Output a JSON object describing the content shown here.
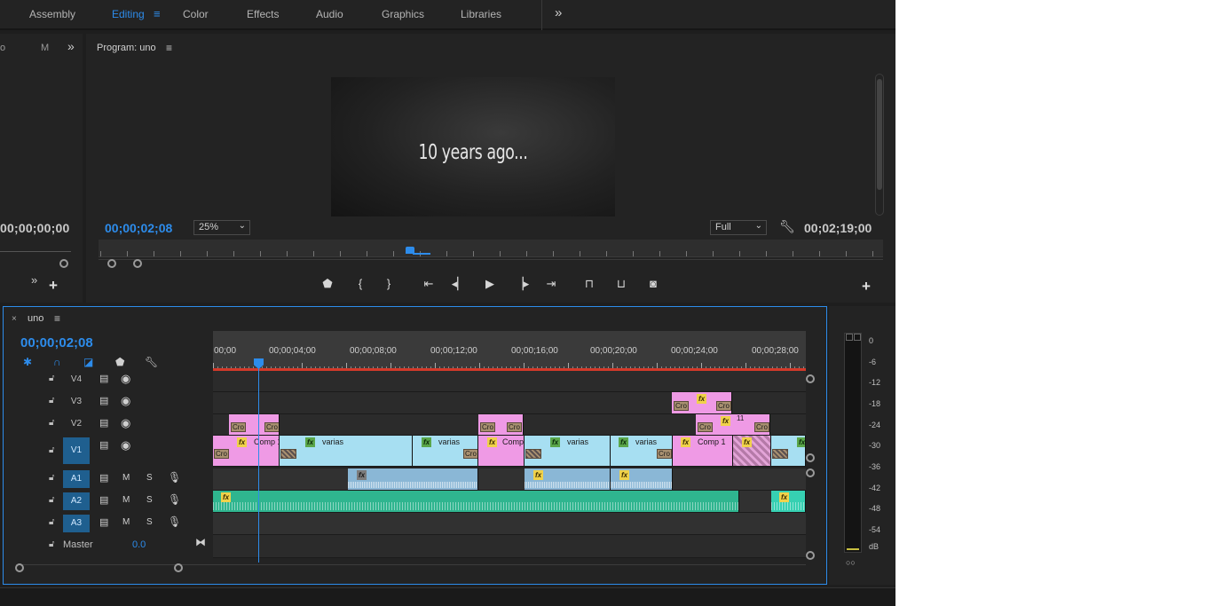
{
  "workspace": {
    "tabs": [
      "Assembly",
      "Editing",
      "Color",
      "Effects",
      "Audio",
      "Graphics",
      "Libraries"
    ],
    "active": "Editing",
    "more_label": "»"
  },
  "source": {
    "tab_partial_1": "o",
    "tab_partial_2": "M",
    "more_label": "»",
    "timecode": "00;00;00;00",
    "add_label": "+"
  },
  "program": {
    "title": "Program: uno",
    "menu_label": "≡",
    "video_text": "10 years ago...",
    "timecode": "00;00;02;08",
    "zoom": "25%",
    "resolution": "Full",
    "duration": "00;02;19;00",
    "add_label": "+"
  },
  "timeline": {
    "sequence_name": "uno",
    "close_label": "×",
    "menu_label": "≡",
    "timecode": "00;00;02;08",
    "ruler_labels": [
      "00;00",
      "00;00;04;00",
      "00;00;08;00",
      "00;00;12;00",
      "00;00;16;00",
      "00;00;20;00",
      "00;00;24;00",
      "00;00;28;00"
    ],
    "video_tracks": [
      "V4",
      "V3",
      "V2",
      "V1"
    ],
    "audio_tracks": [
      "A1",
      "A2",
      "A3"
    ],
    "mute_label": "M",
    "solo_label": "S",
    "master_label": "Master",
    "master_value": "0.0",
    "clip_labels": {
      "cro": "Cro",
      "comp": "Comp",
      "comp1": "Comp 1",
      "varias": "varias",
      "fx": "fx",
      "v2_marker": "11"
    }
  },
  "meter": {
    "labels": [
      "0",
      "-6",
      "-12",
      "-18",
      "-24",
      "-30",
      "-36",
      "-42",
      "-48",
      "-54",
      "dB"
    ],
    "footer": "○○"
  },
  "colors": {
    "accent": "#2d8ceb",
    "pink_clip": "#ef9ae5",
    "cyan_clip": "#a7dff2",
    "audio_blue": "#8ab7d6",
    "audio_green": "#2fb58f",
    "work_area": "#d43a2a"
  }
}
